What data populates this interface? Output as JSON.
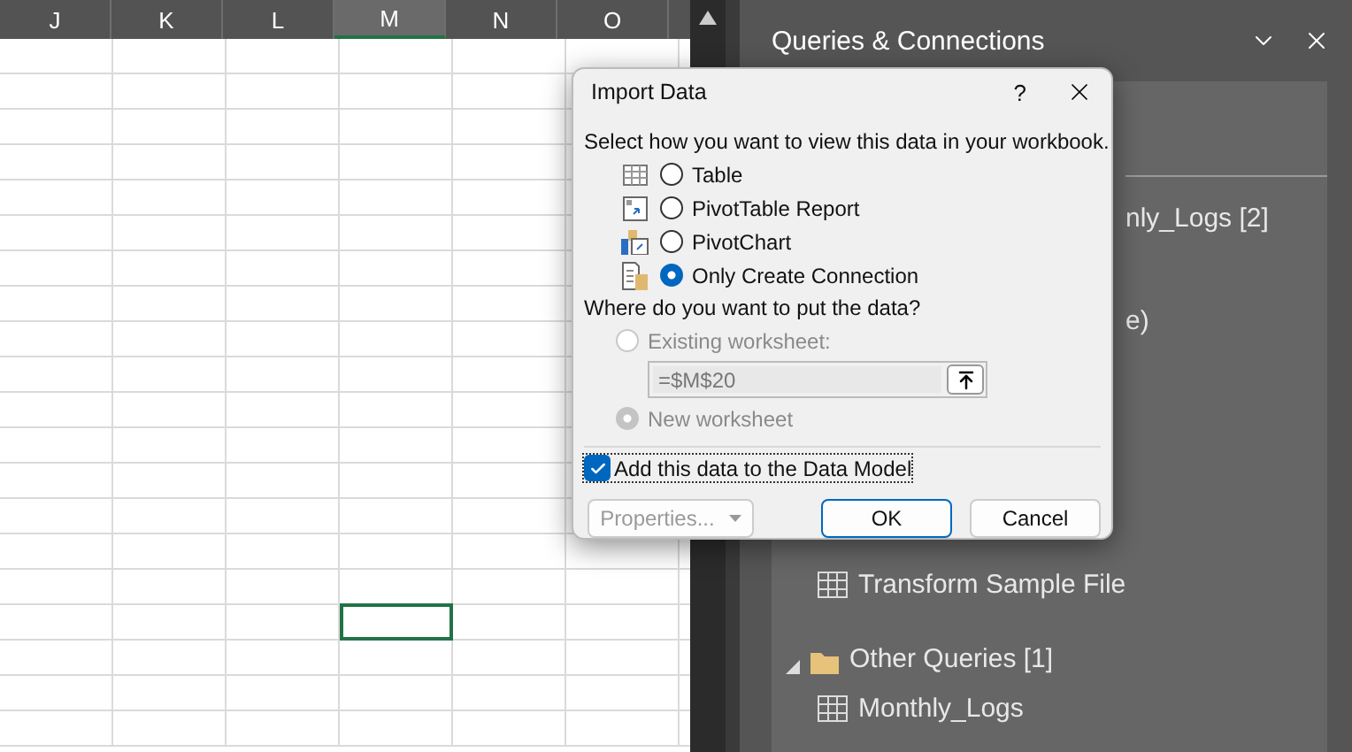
{
  "sheet": {
    "columns": [
      {
        "label": "J",
        "selected": false
      },
      {
        "label": "K",
        "selected": false
      },
      {
        "label": "L",
        "selected": false
      },
      {
        "label": "M",
        "selected": true
      },
      {
        "label": "N",
        "selected": false
      },
      {
        "label": "O",
        "selected": false
      }
    ],
    "rows": [
      {
        "selected": false
      },
      {
        "selected": false
      },
      {
        "selected": false
      },
      {
        "selected": false
      },
      {
        "selected": false
      },
      {
        "selected": false
      },
      {
        "selected": false
      },
      {
        "selected": false
      },
      {
        "selected": false
      },
      {
        "selected": false
      },
      {
        "selected": false
      },
      {
        "selected": false
      },
      {
        "selected": false
      },
      {
        "selected": false
      },
      {
        "selected": false
      },
      {
        "selected": false
      },
      {
        "selected": true
      },
      {
        "selected": false
      },
      {
        "selected": false
      },
      {
        "selected": false
      }
    ]
  },
  "panel": {
    "title": "Queries & Connections",
    "items": [
      {
        "kind": "partial",
        "text": "nly_Logs [2]"
      },
      {
        "kind": "partial",
        "text": "e)"
      },
      {
        "kind": "query",
        "text": "Transform Sample File"
      },
      {
        "kind": "group",
        "text": "Other Queries [1]",
        "expanded": true
      },
      {
        "kind": "query",
        "text": "Monthly_Logs"
      }
    ]
  },
  "dialog": {
    "title": "Import Data",
    "help": "?",
    "prompt": "Select how you want to view this data in your workbook.",
    "view_options": [
      {
        "kind": "table",
        "label": "Table",
        "selected": false
      },
      {
        "kind": "pivottable",
        "label": "PivotTable Report",
        "selected": false
      },
      {
        "kind": "pivotchart",
        "label": "PivotChart",
        "selected": false
      },
      {
        "kind": "connection",
        "label": "Only Create Connection",
        "selected": true
      }
    ],
    "location_prompt": "Where do you want to put the data?",
    "location_options": [
      {
        "label": "Existing worksheet:",
        "selected": false,
        "disabled": true
      },
      {
        "label": "New worksheet",
        "selected": true,
        "disabled": true
      }
    ],
    "range_value": "=$M$20",
    "data_model": {
      "label": "Add this data to the Data Model",
      "checked": true
    },
    "buttons": [
      {
        "kind": "dropdown",
        "label": "Properties...",
        "disabled": true
      },
      {
        "kind": "default",
        "label": "OK",
        "disabled": false
      },
      {
        "kind": "normal",
        "label": "Cancel",
        "disabled": false
      }
    ]
  }
}
